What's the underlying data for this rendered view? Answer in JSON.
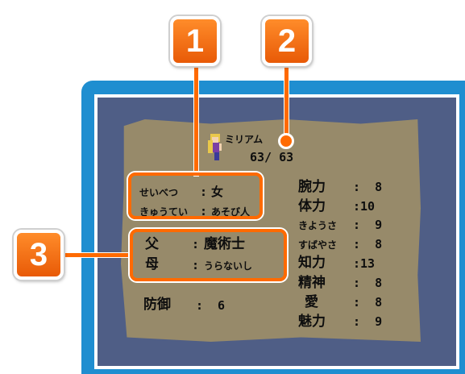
{
  "callouts": {
    "one": "1",
    "two": "2",
    "three": "3"
  },
  "character": {
    "name": "ミリアム",
    "hp": "63/ 63",
    "gender_label": "せいべつ",
    "gender_sep": ":",
    "gender_value": "女",
    "job_label": "きゅうてい",
    "job_sep": ":",
    "job_value": "あそび人",
    "father_label": "父",
    "father_sep": ":",
    "father_value": "魔術士",
    "mother_label": "母",
    "mother_sep": ":",
    "mother_value": "うらないし",
    "defense_label": "防御",
    "defense_sep": ":",
    "defense_value": "6"
  },
  "stats": [
    {
      "label": "腕力",
      "value": ":  8"
    },
    {
      "label": "体力",
      "value": ":10"
    },
    {
      "label": "きようさ",
      "value": ":  9"
    },
    {
      "label": "すばやさ",
      "value": ":  8"
    },
    {
      "label": "知力",
      "value": ":13"
    },
    {
      "label": "精神",
      "value": ":  8"
    },
    {
      "label": "愛",
      "value": ":  8"
    },
    {
      "label": "魅力",
      "value": ":  9"
    }
  ]
}
